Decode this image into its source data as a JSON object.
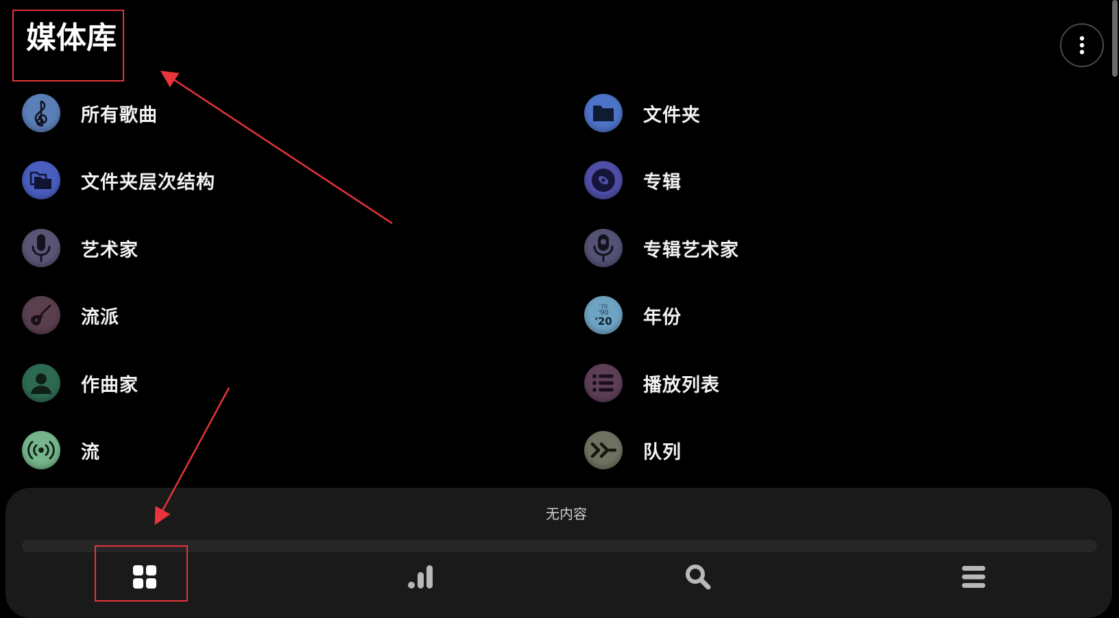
{
  "header": {
    "title": "媒体库"
  },
  "menu": {
    "left": [
      {
        "label": "所有歌曲",
        "icon": "treble-clef-icon",
        "color": "#5b7fb8"
      },
      {
        "label": "文件夹层次结构",
        "icon": "folder-stack-icon",
        "color": "#4a5ec0"
      },
      {
        "label": "艺术家",
        "icon": "microphone-icon",
        "color": "#5b5476"
      },
      {
        "label": "流派",
        "icon": "guitar-icon",
        "color": "#5a3f4e"
      },
      {
        "label": "作曲家",
        "icon": "person-icon",
        "color": "#2e6a52"
      },
      {
        "label": "流",
        "icon": "broadcast-icon",
        "color": "#77b68c"
      }
    ],
    "right": [
      {
        "label": "文件夹",
        "icon": "folder-icon",
        "color": "#4d74c9"
      },
      {
        "label": "专辑",
        "icon": "disc-icon",
        "color": "#4f4fa8"
      },
      {
        "label": "专辑艺术家",
        "icon": "podcast-mic-icon",
        "color": "#545275"
      },
      {
        "label": "年份",
        "icon": "years-icon",
        "color": "#6fa3c2",
        "icon_text": [
          "'70",
          "'90",
          "'20"
        ]
      },
      {
        "label": "播放列表",
        "icon": "list-icon",
        "color": "#5d3f58"
      },
      {
        "label": "队列",
        "icon": "fast-forward-icon",
        "color": "#6e7260"
      }
    ]
  },
  "player": {
    "empty_text": "无内容",
    "progress": 0
  },
  "nav": [
    {
      "icon": "library-grid-icon",
      "active": true
    },
    {
      "icon": "stats-bars-icon",
      "active": false
    },
    {
      "icon": "search-icon",
      "active": false
    },
    {
      "icon": "menu-lines-icon",
      "active": false
    }
  ],
  "colors": {
    "background": "#000000",
    "panel": "#1a1a1a",
    "highlight": "#e8343a",
    "text": "#f2f2f2"
  }
}
